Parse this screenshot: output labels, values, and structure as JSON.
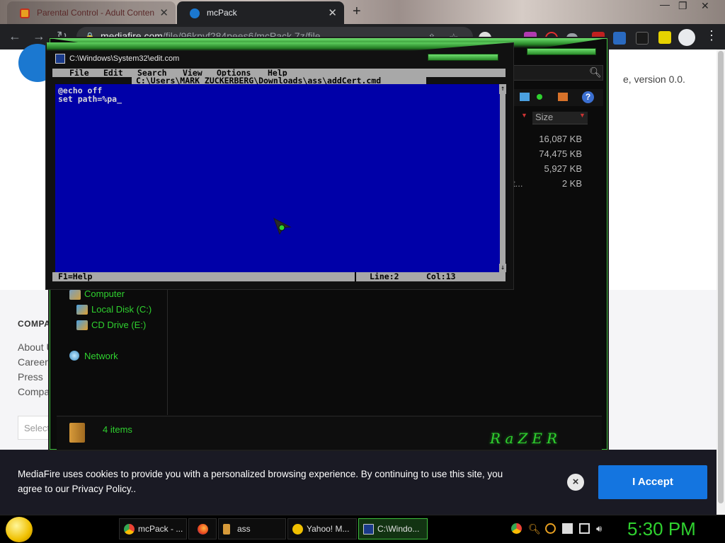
{
  "browser": {
    "tabs": [
      {
        "title": "Parental Control - Adult Conten",
        "active": false
      },
      {
        "title": "mcPack",
        "active": true
      }
    ],
    "new_tab": "+",
    "url_host": "mediafire.com",
    "url_path": "/file/96kpyf284pees6/mcPack.7z/file",
    "window_controls": {
      "minimize": "—",
      "restore": "❐",
      "close": "✕"
    }
  },
  "page": {
    "version_text": "e, version 0.0.",
    "company_heading": "COMPA",
    "footer_links": [
      "About U",
      "Careers",
      "Press",
      "Compa"
    ],
    "select_placeholder": "Select"
  },
  "cookie": {
    "text": "MediaFire uses cookies to provide you with a personalized browsing experience. By continuing to use this site, you agree to our Privacy Policy..",
    "close": "×",
    "accept": "I Accept"
  },
  "explorer": {
    "size_header": "Size",
    "sizes": [
      "16,087 KB",
      "74,475 KB",
      "5,927 KB",
      "2 KB"
    ],
    "truncated_name": "t...",
    "tree": [
      {
        "label": "Computer",
        "indent": false
      },
      {
        "label": "Local Disk (C:)",
        "indent": true
      },
      {
        "label": "CD Drive (E:)",
        "indent": true
      },
      {
        "label": "Network",
        "indent": false
      }
    ],
    "status": "4 items",
    "brand": "RaZER",
    "help_icon": "?"
  },
  "edit": {
    "title": "C:\\Windows\\System32\\edit.com",
    "menu": [
      "File",
      "Edit",
      "Search",
      "View",
      "Options",
      "Help"
    ],
    "filepath": "C:\\Users\\MARK ZUCKERBERG\\Downloads\\ass\\addCert.cmd",
    "lines": [
      "@echo off",
      "set path=%pa_"
    ],
    "status_help": "F1=Help",
    "status_line": "Line:2",
    "status_col": "Col:13",
    "scroll_up": "↑",
    "scroll_down": "↓"
  },
  "taskbar": {
    "items": [
      {
        "label": "mcPack - ...",
        "icon": "chrome-icon"
      },
      {
        "label": "",
        "icon": "firefox-icon"
      },
      {
        "label": "ass",
        "icon": "folder-icon"
      },
      {
        "label": "Yahoo! M...",
        "icon": "yahoo-messenger-icon"
      },
      {
        "label": "C:\\Windo...",
        "icon": "dos-edit-icon"
      }
    ],
    "clock": "5:30 PM"
  },
  "colors": {
    "razer_green": "#2fd12f",
    "dos_blue": "#0000a8",
    "dos_gray": "#a8a8a8",
    "mediafire_blue": "#1475e0"
  }
}
